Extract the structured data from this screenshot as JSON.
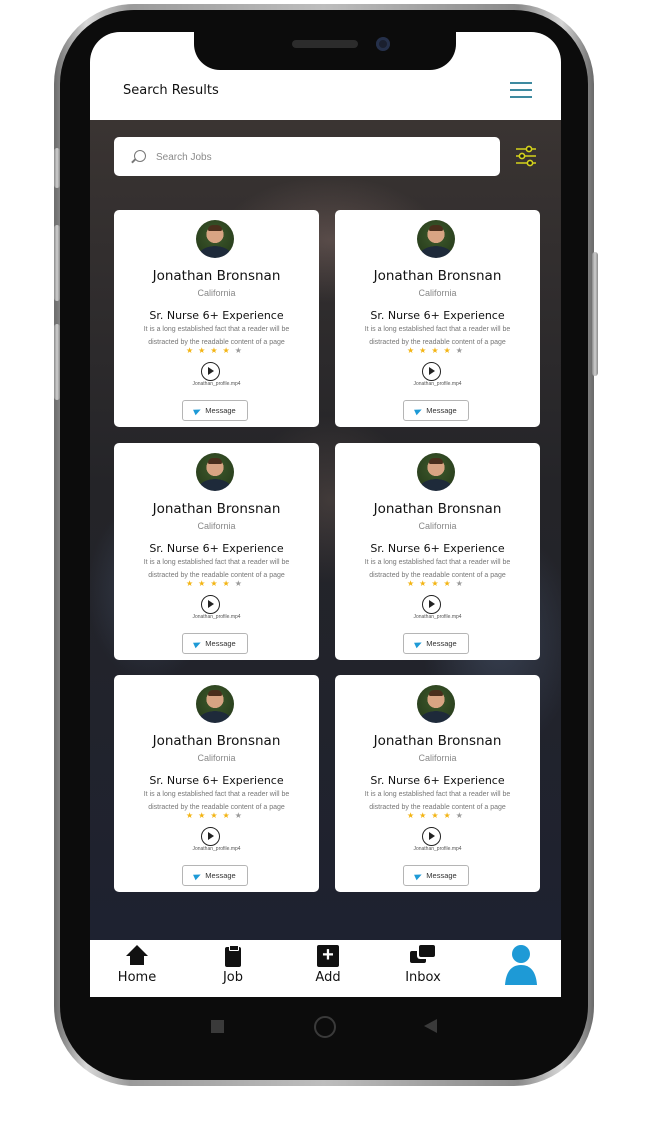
{
  "header": {
    "title": "Search Results"
  },
  "search": {
    "placeholder": "Search Jobs"
  },
  "cards": [
    {
      "name": "Jonathan Bronsnan",
      "location": "California",
      "title": "Sr. Nurse 6+ Experience",
      "description": "It is a long established fact that a reader will be distracted by the readable content of a page",
      "rating": 4,
      "video": "Jonathan_profile.mp4",
      "message_label": "Message"
    },
    {
      "name": "Jonathan Bronsnan",
      "location": "California",
      "title": "Sr. Nurse 6+ Experience",
      "description": "It is a long established fact that a reader will be distracted by the readable content of a page",
      "rating": 4,
      "video": "Jonathan_profile.mp4",
      "message_label": "Message"
    },
    {
      "name": "Jonathan Bronsnan",
      "location": "California",
      "title": "Sr. Nurse 6+ Experience",
      "description": "It is a long established fact that a reader will be distracted by the readable content of a page",
      "rating": 4,
      "video": "Jonathan_profile.mp4",
      "message_label": "Message"
    },
    {
      "name": "Jonathan Bronsnan",
      "location": "California",
      "title": "Sr. Nurse 6+ Experience",
      "description": "It is a long established fact that a reader will be distracted by the readable content of a page",
      "rating": 4,
      "video": "Jonathan_profile.mp4",
      "message_label": "Message"
    },
    {
      "name": "Jonathan Bronsnan",
      "location": "California",
      "title": "Sr. Nurse 6+ Experience",
      "description": "It is a long established fact that a reader will be distracted by the readable content of a page",
      "rating": 4,
      "video": "Jonathan_profile.mp4",
      "message_label": "Message"
    },
    {
      "name": "Jonathan Bronsnan",
      "location": "California",
      "title": "Sr. Nurse 6+ Experience",
      "description": "It is a long established fact that a reader will be distracted by the readable content of a page",
      "rating": 4,
      "video": "Jonathan_profile.mp4",
      "message_label": "Message"
    }
  ],
  "nav": {
    "home_label": "Home",
    "job_label": "Job",
    "add_label": "Add",
    "inbox_label": "Inbox"
  },
  "icons": {
    "menu": "hamburger-menu-icon",
    "search": "search-icon",
    "filter": "filter-sliders-icon",
    "profile": "profile-person-icon"
  },
  "colors": {
    "accent": "#3e8aa0",
    "filter": "#d4d21c",
    "star": "#f3b413",
    "profile": "#1e9ad6"
  }
}
